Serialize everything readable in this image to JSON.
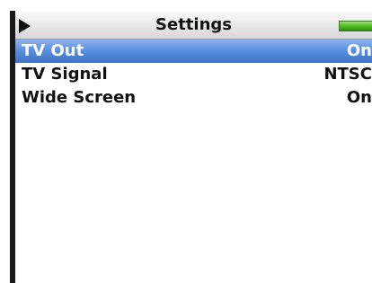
{
  "header": {
    "title": "Settings",
    "left_icon": "play-icon",
    "right_icon": "battery-icon"
  },
  "colors": {
    "selection": "#5489db",
    "battery": "#47b418",
    "text": "#111111"
  },
  "settings": [
    {
      "label": "TV Out",
      "value": "On",
      "selected": true
    },
    {
      "label": "TV Signal",
      "value": "NTSC",
      "selected": false
    },
    {
      "label": "Wide Screen",
      "value": "On",
      "selected": false
    }
  ]
}
